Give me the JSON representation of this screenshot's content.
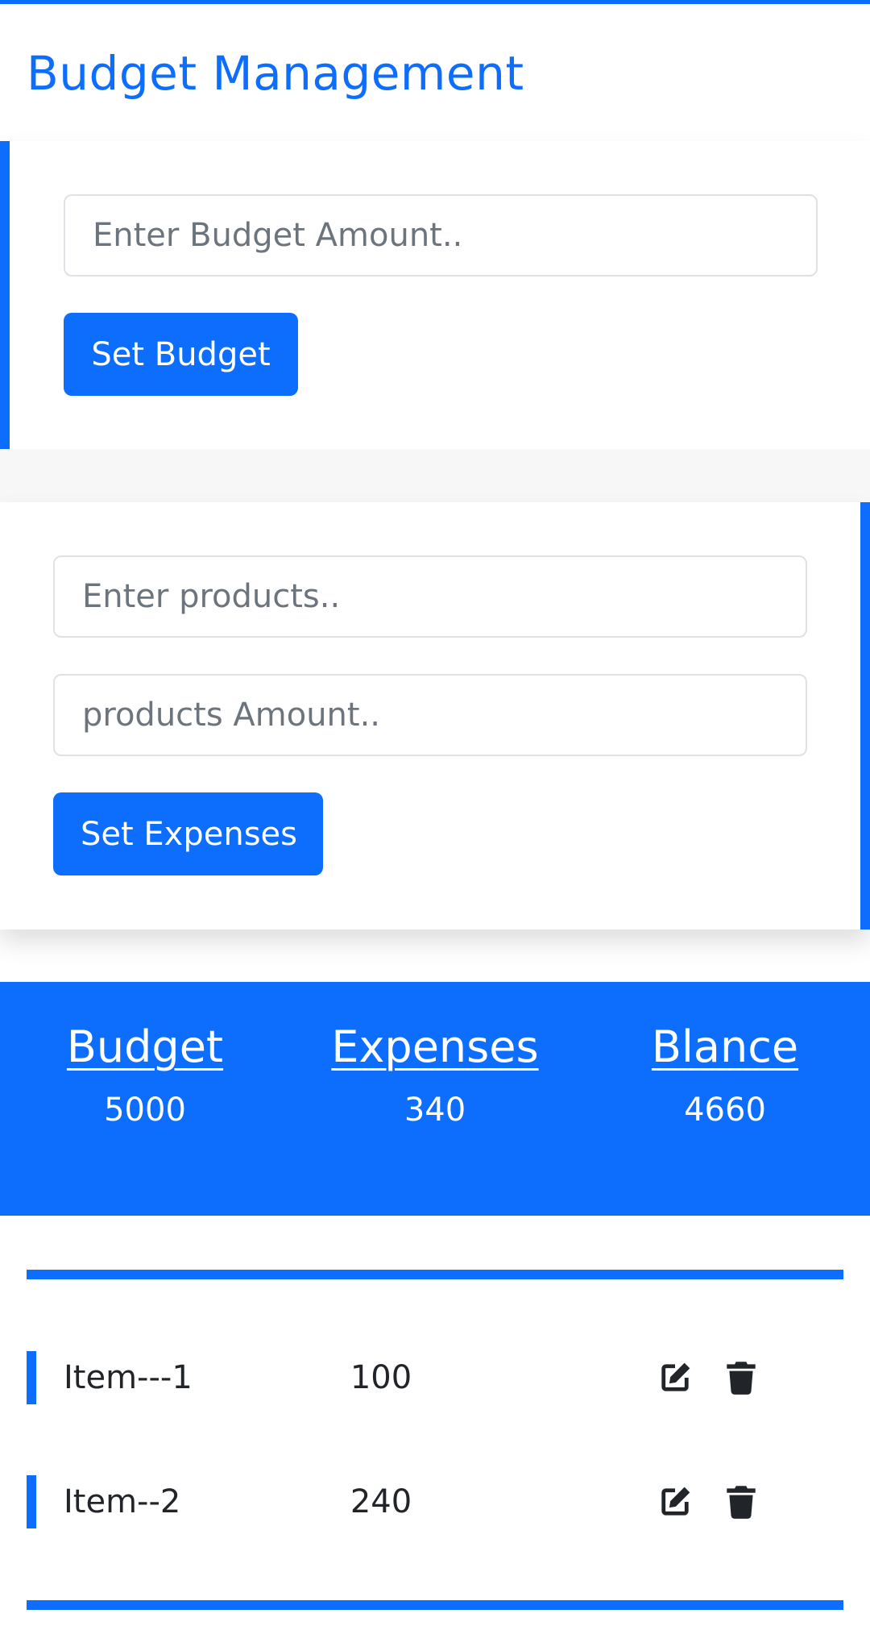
{
  "app": {
    "title": "Budget Management",
    "accent_color": "#0d6efd"
  },
  "budget_form": {
    "budget_input": {
      "value": "",
      "placeholder": "Enter Budget Amount.."
    },
    "set_budget_label": "Set Budget"
  },
  "expense_form": {
    "product_input": {
      "value": "",
      "placeholder": "Enter products.."
    },
    "amount_input": {
      "value": "",
      "placeholder": "products Amount.."
    },
    "set_expenses_label": "Set Expenses"
  },
  "summary": {
    "budget": {
      "label": "Budget",
      "value": "5000"
    },
    "expenses": {
      "label": "Expenses",
      "value": "340"
    },
    "balance": {
      "label": "Blance",
      "value": "4660"
    }
  },
  "expense_list": {
    "items": [
      {
        "name": "Item---1",
        "amount": "100",
        "edit_icon": "edit-icon",
        "delete_icon": "trash-icon"
      },
      {
        "name": "Item--2",
        "amount": "240",
        "edit_icon": "edit-icon",
        "delete_icon": "trash-icon"
      }
    ]
  }
}
